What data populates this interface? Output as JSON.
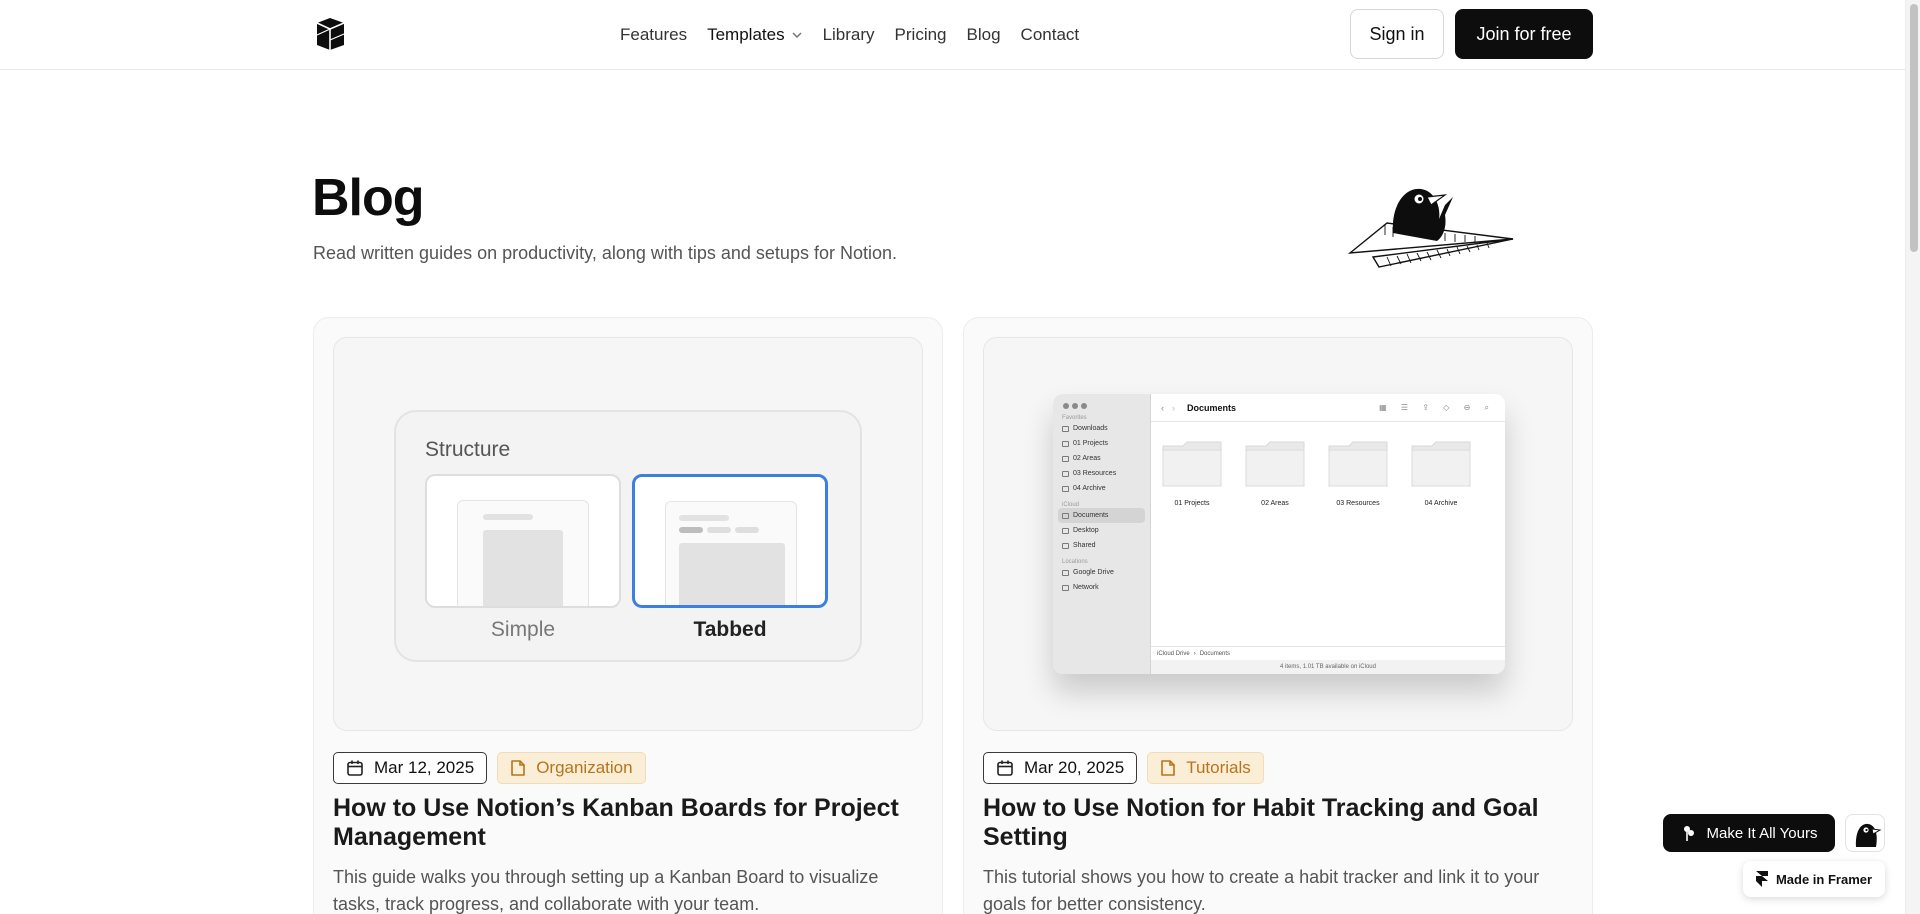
{
  "nav": {
    "items": [
      {
        "label": "Features"
      },
      {
        "label": "Templates",
        "has_dropdown": true
      },
      {
        "label": "Library"
      },
      {
        "label": "Pricing"
      },
      {
        "label": "Blog"
      },
      {
        "label": "Contact"
      }
    ],
    "sign_in": "Sign in",
    "join": "Join for free"
  },
  "hero": {
    "title": "Blog",
    "subtitle": "Read written guides on productivity, along with tips and setups for Notion."
  },
  "posts": [
    {
      "date": "Mar 12, 2025",
      "category": "Organization",
      "title": "How to Use Notion’s Kanban Boards for Project Management",
      "description": "This guide walks you through setting up a Kanban Board to visualize tasks, track progress, and collaborate with your team.",
      "illustration": {
        "heading": "Structure",
        "option_simple": "Simple",
        "option_tabbed": "Tabbed",
        "selected": "Tabbed"
      }
    },
    {
      "date": "Mar 20, 2025",
      "category": "Tutorials",
      "title": "How to Use Notion for Habit Tracking and Goal Setting",
      "description": "This tutorial shows you how to create a habit tracker and link it to your goals for better consistency.",
      "illustration": {
        "window_title": "Documents",
        "sidebar": {
          "favorites_label": "Favorites",
          "favorites": [
            "Downloads",
            "01 Projects",
            "02 Areas",
            "03 Resources",
            "04 Archive"
          ],
          "icloud_label": "iCloud",
          "icloud": [
            "Documents",
            "Desktop",
            "Shared"
          ],
          "locations_label": "Locations",
          "locations": [
            "Google Drive",
            "Network"
          ]
        },
        "folders": [
          "01 Projects",
          "02 Areas",
          "03 Resources",
          "04 Archive"
        ],
        "path": [
          "iCloud Drive",
          "Documents"
        ],
        "status": "4 items, 1.01 TB available on iCloud"
      }
    }
  ],
  "floating": {
    "make_it_yours": "Make It All Yours",
    "made_in_framer": "Made in Framer"
  },
  "colors": {
    "accent_blue": "#3d7fe0",
    "category_text": "#b8741a",
    "category_bg": "#fbeed7",
    "primary_button": "#0d0d0d"
  },
  "icons": [
    "cube-logo-icon",
    "chevron-down-icon",
    "calendar-icon",
    "document-icon",
    "bird-icon",
    "framer-icon",
    "flower-icon"
  ]
}
